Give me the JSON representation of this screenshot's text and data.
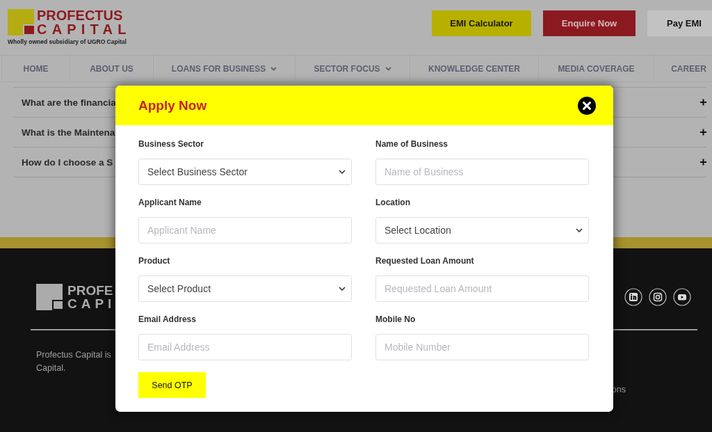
{
  "header": {
    "logo": {
      "line1": "PROFECTUS",
      "line2": "CAPITAL",
      "tagline": "Wholly owned subsidiary of UGRO Capital"
    },
    "buttons": [
      {
        "label": "EMI Calculator",
        "kind": "yellow"
      },
      {
        "label": "Enquire Now",
        "kind": "red"
      },
      {
        "label": "Pay EMI",
        "kind": "grey"
      }
    ]
  },
  "nav": [
    {
      "label": "HOME",
      "has_menu": false
    },
    {
      "label": "ABOUT US",
      "has_menu": false
    },
    {
      "label": "LOANS FOR BUSINESS",
      "has_menu": true
    },
    {
      "label": "SECTOR FOCUS",
      "has_menu": true
    },
    {
      "label": "KNOWLEDGE CENTER",
      "has_menu": false
    },
    {
      "label": "MEDIA COVERAGE",
      "has_menu": false
    },
    {
      "label": "CAREER",
      "has_menu": false
    }
  ],
  "faq": [
    {
      "question": "What are the financia",
      "expanded": false
    },
    {
      "question": "What is the Maintena",
      "expanded": false
    },
    {
      "question": "How do I choose a S",
      "expanded": false
    }
  ],
  "footer": {
    "logo": {
      "line1": "PROFE",
      "line2": "CAPI"
    },
    "about": "Profectus Capital is",
    "about_line2": "Capital.",
    "right_text": "ons",
    "social": [
      {
        "kind": "linkedin"
      },
      {
        "kind": "instagram"
      },
      {
        "kind": "youtube"
      }
    ]
  },
  "modal": {
    "title": "Apply Now",
    "fields": [
      {
        "label": "Business Sector",
        "kind": "select",
        "value": "Select Business Sector"
      },
      {
        "label": "Name of Business",
        "kind": "input",
        "placeholder": "Name of Business"
      },
      {
        "label": "Applicant Name",
        "kind": "input",
        "placeholder": "Applicant Name"
      },
      {
        "label": "Location",
        "kind": "select",
        "value": "Select Location"
      },
      {
        "label": "Product",
        "kind": "select",
        "value": "Select Product"
      },
      {
        "label": "Requested Loan Amount",
        "kind": "input",
        "placeholder": "Requested Loan Amount"
      },
      {
        "label": "Email Address",
        "kind": "input",
        "placeholder": "Email Address"
      },
      {
        "label": "Mobile No",
        "kind": "input",
        "placeholder": "Mobile Number"
      }
    ],
    "submit": "Send OTP"
  }
}
